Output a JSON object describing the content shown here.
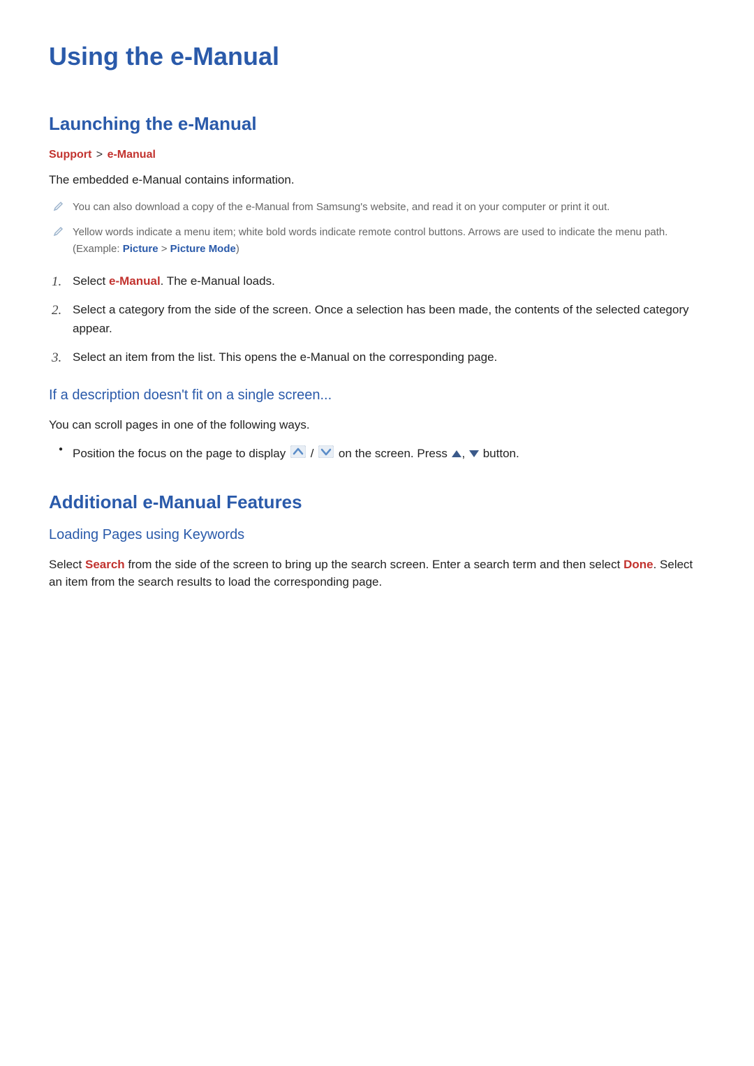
{
  "title": "Using the e-Manual",
  "section1": {
    "heading": "Launching the e-Manual",
    "breadcrumb": {
      "part1": "Support",
      "part2": "e-Manual"
    },
    "intro": "The embedded e-Manual contains information.",
    "notes": [
      {
        "text": "You can also download a copy of the e-Manual from Samsung's website, and read it on your computer or print it out."
      },
      {
        "before": "Yellow words indicate a menu item; white bold words indicate remote control buttons. Arrows are used to indicate the menu path. (Example: ",
        "link1": "Picture",
        "link2": "Picture Mode",
        "after": ")"
      }
    ],
    "steps": [
      {
        "num": "1.",
        "before": "Select ",
        "link": "e-Manual",
        "after": ". The e-Manual loads."
      },
      {
        "num": "2.",
        "text": "Select a category from the side of the screen. Once a selection has been made, the contents of the selected category appear."
      },
      {
        "num": "3.",
        "text": "Select an item from the list. This opens the e-Manual on the corresponding page."
      }
    ],
    "sub": {
      "heading": "If a description doesn't fit on a single screen...",
      "text": "You can scroll pages in one of the following ways.",
      "bullet": {
        "before": "Position the focus on the page to display ",
        "mid": " / ",
        "after1": " on the screen. Press ",
        "comma": ", ",
        "after2": " button."
      }
    }
  },
  "section2": {
    "heading": "Additional e-Manual Features",
    "sub": {
      "heading": "Loading Pages using Keywords",
      "before": "Select ",
      "link1": "Search",
      "mid": " from the side of the screen to bring up the search screen. Enter a search term and then select ",
      "link2": "Done",
      "after": ". Select an item from the search results to load the corresponding page."
    }
  }
}
